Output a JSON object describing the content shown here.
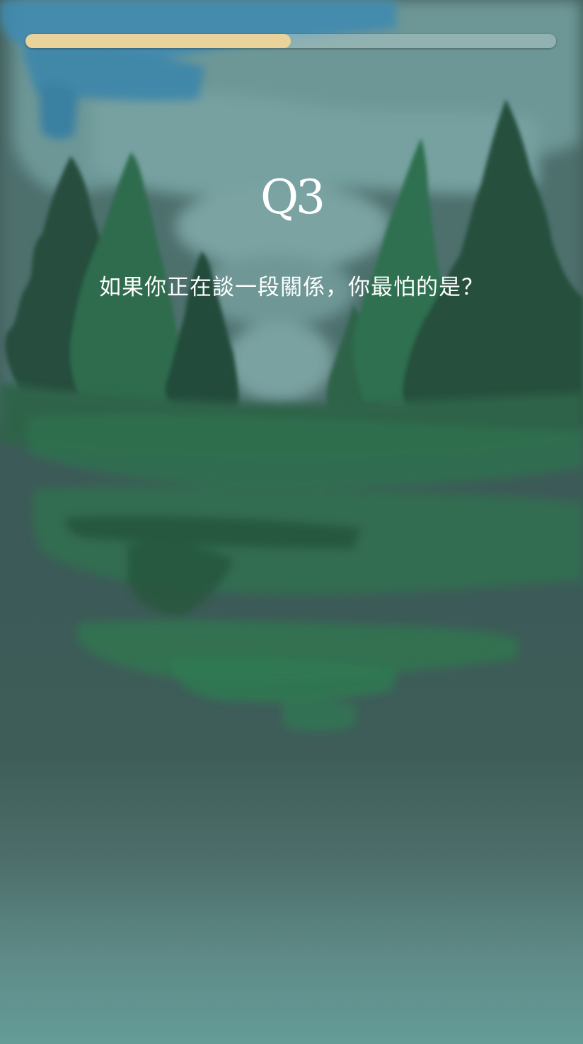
{
  "progress": {
    "value": 0.5
  },
  "question": {
    "number": "Q3",
    "text": "如果你正在談一段關係，你最怕的是？"
  },
  "theme": {
    "progress_fill": "#e9d39b",
    "sky": "#5f8b89",
    "forest_dark": "#24503c",
    "forest_light": "#2f7a4f"
  },
  "illustration": {
    "icon": "watercolor-forest-illustration"
  }
}
